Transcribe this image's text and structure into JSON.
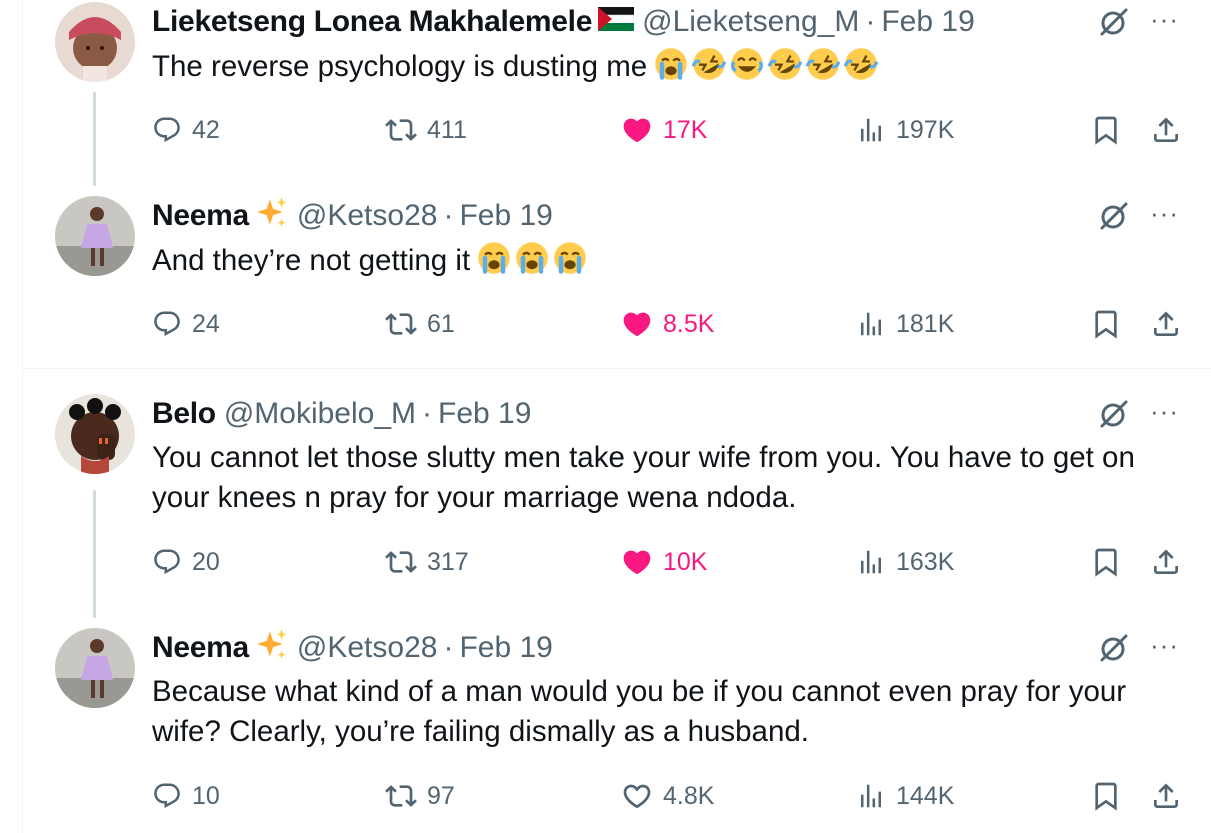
{
  "tweets": [
    {
      "name": "Lieketseng Lonea Makhalemele",
      "handle": "@Lieketseng_M",
      "date": "Feb 19",
      "text": "The reverse psychology is dusting me",
      "emojis": [
        "loudly-crying-face",
        "rolling-on-floor-laughing",
        "face-with-tears-of-joy",
        "rolling-on-floor-laughing",
        "rolling-on-floor-laughing",
        "rolling-on-floor-laughing"
      ],
      "name_badge": "palestine-flag",
      "replies": "42",
      "reposts": "411",
      "likes": "17K",
      "views": "197K",
      "liked": true
    },
    {
      "name": "Neema",
      "handle": "@Ketso28",
      "date": "Feb 19",
      "text": "And they’re not getting it",
      "emojis": [
        "loudly-crying-face",
        "loudly-crying-face",
        "loudly-crying-face"
      ],
      "name_badge": "sparkles",
      "replies": "24",
      "reposts": "61",
      "likes": "8.5K",
      "views": "181K",
      "liked": true
    },
    {
      "name": "Belo",
      "handle": "@Mokibelo_M",
      "date": "Feb 19",
      "text": "You cannot let those slutty men take your wife from you. You have to get on your knees n pray for your marriage wena ndoda.",
      "emojis": [],
      "name_badge": "",
      "replies": "20",
      "reposts": "317",
      "likes": "10K",
      "views": "163K",
      "liked": true
    },
    {
      "name": "Neema",
      "handle": "@Ketso28",
      "date": "Feb 19",
      "text": "Because what kind of a man would you be if you cannot even pray for your wife? Clearly, you’re failing dismally as a husband.",
      "emojis": [],
      "name_badge": "sparkles",
      "replies": "10",
      "reposts": "97",
      "likes": "4.8K",
      "views": "144K",
      "liked": false
    }
  ],
  "colors": {
    "text": "#0f1419",
    "muted": "#536471",
    "like": "#f91880",
    "divider": "#eff3f4",
    "thread": "#cfd9de"
  },
  "separator": "·",
  "more_label": "···"
}
